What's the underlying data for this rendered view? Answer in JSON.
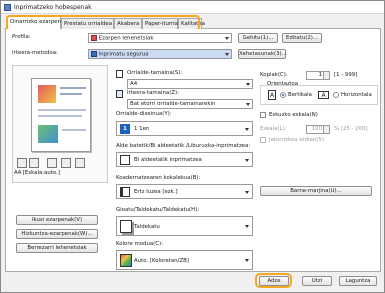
{
  "window": {
    "title": "Inprimatzeko hobespenak"
  },
  "tabs": [
    {
      "label": "Oinarrizko ezarpenak",
      "active": true
    },
    {
      "label": "Prestatu orrialdea",
      "active": false
    },
    {
      "label": "Akabera",
      "active": false
    },
    {
      "label": "Paper-iturria",
      "active": false
    },
    {
      "label": "Kalitatea",
      "active": false
    }
  ],
  "profile": {
    "label": "Profila:",
    "value": "Ezarpen lehenetsiak",
    "add_button": "Gehitu(1)...",
    "edit_button": "Editatu(2)..."
  },
  "output_method": {
    "label": "Irteera-metodoa:",
    "value": "Inprimatu segurua",
    "details_button": "Xehetasunak(3)..."
  },
  "preview": {
    "caption": "A4 [Eskala:auto.]"
  },
  "left_buttons": {
    "show_settings": "Ikusi ezarpenak(V)",
    "restore_defaults": "Hizkuntza-ezarpenak(W)...",
    "reset": "Berrezarri lehenetsiak"
  },
  "page_size": {
    "label": "Orrialde-tamaina(S):",
    "value": "A4"
  },
  "output_size": {
    "label": "Irteera-tamaina(Z):",
    "value": "Bat etorri orrialde-tamainarekin"
  },
  "copies": {
    "label": "Kopiak(C):",
    "value": "1",
    "range": "[1 - 999]"
  },
  "orientation": {
    "label": "Orientazioa",
    "portrait": "Bertikala",
    "landscape": "Horizontala",
    "selected": "portrait"
  },
  "layout": {
    "label": "Orrialde-diseinua(Y):",
    "value": "1 1en"
  },
  "manual_scaling": {
    "label": "Eskuzko eskala(N)",
    "scale_label": "Eskala(L):",
    "scale_value": "100",
    "scale_range": "% [25 - 200]",
    "watermark_label": "Jatorrizkoa erdian(5)"
  },
  "duplex": {
    "label": "Alde batetik/Bi aldeetatik./Liburuxka-inprimatzea:",
    "value": "Bi aldeetatik inprimatzea"
  },
  "binding": {
    "label": "Koadernatzearen kokalekua(B):",
    "value": "Ertz luzea [ezk.]",
    "margin_button": "Barne-marjina(U)..."
  },
  "collate": {
    "label": "Gioatu/Taldekatu/Taldekatu(H):",
    "value": "Taldekatu"
  },
  "color_mode": {
    "label": "Kolore modua(C):",
    "value": "Auto. [Koloretan/ZB]"
  },
  "footer": {
    "ok": "Ados",
    "cancel": "Utzi",
    "help": "Laguntza"
  },
  "colors": {
    "highlight": "#f5a623",
    "accent": "#1f5fbf",
    "select_highlight": "#c9daf2"
  }
}
